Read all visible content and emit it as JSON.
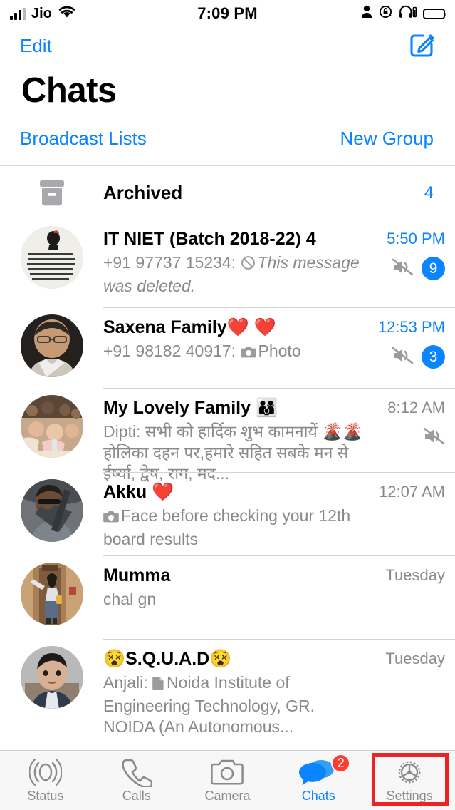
{
  "status_bar": {
    "carrier": "Jio",
    "time": "7:09 PM",
    "icons": [
      "signal-bars-icon",
      "wifi-icon",
      "person-icon",
      "rotation-lock-icon",
      "headphones-icon",
      "battery-icon"
    ]
  },
  "nav": {
    "edit_label": "Edit",
    "compose_icon": "compose-icon"
  },
  "header": {
    "title": "Chats",
    "broadcast_lists": "Broadcast Lists",
    "new_group": "New Group"
  },
  "archived": {
    "label": "Archived",
    "count": "4",
    "icon": "archive-box-icon"
  },
  "chats": [
    {
      "name": "IT NIET (Batch 2018-22) 4",
      "preview_prefix": "+91 97737 15234: ",
      "preview_icon": "blocked-icon",
      "preview": "This message was deleted.",
      "preview_italic": true,
      "time": "5:50 PM",
      "time_blue": true,
      "muted": true,
      "unread": "9",
      "avatar": "quote-image-avatar"
    },
    {
      "name": "Saxena Family❤️ ❤️",
      "preview_prefix": "+91 98182 40917: ",
      "preview_icon": "camera-icon",
      "preview": "Photo",
      "preview_italic": false,
      "time": "12:53 PM",
      "time_blue": true,
      "muted": true,
      "unread": "3",
      "avatar": "elderly-man-avatar"
    },
    {
      "name": "My Lovely Family 👨‍👩‍👦",
      "preview_prefix": "Dipti: ",
      "preview_icon": "",
      "preview": "सभी को हार्दिक शुभ कामनायें 🌋🌋होलिका दहन पर,हमारे सहित  सबके मन से ईर्ष्या, द्वेष, राग, मद...",
      "preview_italic": false,
      "time": "8:12 AM",
      "time_blue": false,
      "muted": true,
      "unread": "",
      "avatar": "group-photo-avatar"
    },
    {
      "name": "Akku ❤️",
      "preview_prefix": "",
      "preview_icon": "camera-icon",
      "preview": "Face before checking your 12th board results",
      "preview_italic": false,
      "time": "12:07 AM",
      "time_blue": false,
      "muted": false,
      "unread": "",
      "avatar": "man-sunglasses-avatar"
    },
    {
      "name": "Mumma",
      "preview_prefix": "",
      "preview_icon": "",
      "preview": "chal gn",
      "preview_italic": false,
      "time": "Tuesday",
      "time_blue": false,
      "muted": false,
      "unread": "",
      "avatar": "woman-doorway-avatar"
    },
    {
      "name": "😵S.Q.U.A.D😵",
      "preview_prefix": "Anjali: ",
      "preview_icon": "document-icon",
      "preview": "Noida Institute of Engineering Technology, GR. NOIDA (An Autonomous...",
      "preview_italic": false,
      "time": "Tuesday",
      "time_blue": false,
      "muted": false,
      "unread": "",
      "avatar": "boy-avatar"
    }
  ],
  "tabs": [
    {
      "label": "Status",
      "icon": "status-rings-icon",
      "active": false,
      "badge": ""
    },
    {
      "label": "Calls",
      "icon": "phone-icon",
      "active": false,
      "badge": ""
    },
    {
      "label": "Camera",
      "icon": "camera-icon",
      "active": false,
      "badge": ""
    },
    {
      "label": "Chats",
      "icon": "chat-bubbles-icon",
      "active": true,
      "badge": "2"
    },
    {
      "label": "Settings",
      "icon": "gear-icon",
      "active": false,
      "badge": ""
    }
  ],
  "annotation": {
    "highlight_target": "settings-tab",
    "color": "#ee2222"
  }
}
